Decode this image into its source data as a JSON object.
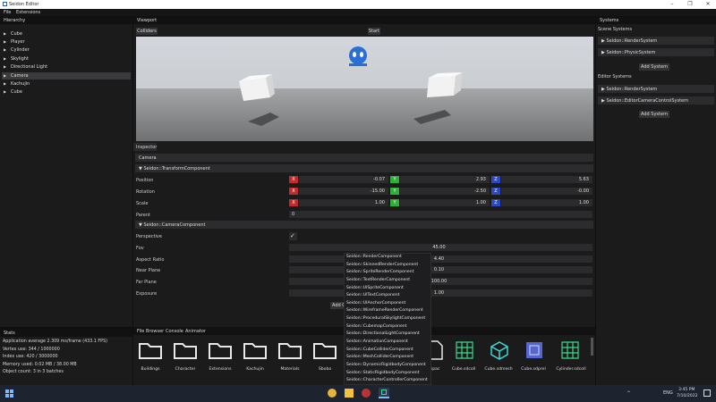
{
  "window": {
    "title": "Seidon Editor"
  },
  "menu": [
    "File",
    "Extensions"
  ],
  "hierarchy": {
    "title": "Hierarchy",
    "items": [
      "Cube",
      "Player",
      "Cylinder",
      "Skylight",
      "Directional Light",
      "Camera",
      "Kachujin",
      "Cube"
    ],
    "selected": "Camera"
  },
  "viewport": {
    "title": "Viewport",
    "colliders_label": "Colliders",
    "start_label": "Start"
  },
  "inspector": {
    "tab": "Inspector",
    "entity_name": "Camera",
    "transform": {
      "header": "Seidon::TransformComponent",
      "position": {
        "label": "Position",
        "x": "-0.07",
        "y": "2.93",
        "z": "5.63"
      },
      "rotation": {
        "label": "Rotation",
        "x": "-15.00",
        "y": "-2.50",
        "z": "-0.00"
      },
      "scale": {
        "label": "Scale",
        "x": "1.00",
        "y": "1.00",
        "z": "1.00"
      },
      "parent": {
        "label": "Parent",
        "value": "0"
      },
      "axis_labels": [
        "X",
        "Y",
        "Z"
      ]
    },
    "camera": {
      "header": "Seidon::CameraComponent",
      "perspective": "Perspective",
      "fov": {
        "label": "Fov",
        "value": "45.00"
      },
      "aspect": {
        "label": "Aspect Ratio",
        "value": "4.40"
      },
      "near": {
        "label": "Near Plane",
        "value": "0.10"
      },
      "far": {
        "label": "Far Plane",
        "value": "100.00"
      },
      "exposure": {
        "label": "Exposure",
        "value": "1.00"
      }
    },
    "add_component_label": "Add C"
  },
  "component_dropdown": [
    "Seidon::RenderComponent",
    "Seidon::SkinnedRenderComponent",
    "Seidon::SpriteRenderComponent",
    "Seidon::TextRenderComponent",
    "Seidon::UISpriteComponent",
    "Seidon::UITextComponent",
    "Seidon::UIAnchorComponent",
    "Seidon::WireframeRenderComponent",
    "Seidon::ProceduralSkylightComponent",
    "Seidon::CubemapComponent",
    "Seidon::DirectionalLightComponent",
    "Seidon::AnimationComponent",
    "Seidon::CubeColliderComponent",
    "Seidon::MeshColliderComponent",
    "Seidon::DynamicRigidbodyComponent",
    "Seidon::StaticRigidbodyComponent",
    "Seidon::CharacterControllerComponent"
  ],
  "systems": {
    "title": "Systems",
    "scene_label": "Scene Systems",
    "scene": [
      "Seidon::RenderSystem",
      "Seidon::PhysicSystem"
    ],
    "editor_label": "Editor Systems",
    "editor": [
      "Seidon::RenderSystem",
      "Seidon::EditorCameraControlSystem"
    ],
    "add_label": "Add System"
  },
  "stats": {
    "title": "Stats",
    "lines": [
      "Application average 2.309 ms/frame (433.1 FPS)",
      "Vertex use: 344 / 1000000",
      "Index use: 420 / 3000000",
      "Memory used: 0.02 MB / 38.00 MB",
      "Object count: 3 in 3 batches"
    ]
  },
  "file_browser": {
    "tabs": [
      "File Browser",
      "Console",
      "Animator"
    ],
    "items": [
      "Buildings",
      "Character",
      "Extensions",
      "Kachujin",
      "Materials",
      "Sbobo",
      "...spac",
      "Cube.sdcoll",
      "Cube.sdmesh",
      "Cube.sdprel",
      "Cylinder.sdcoll"
    ]
  },
  "taskbar": {
    "time": "3:45 PM",
    "date": "7/10/2022",
    "lang": "ENG"
  },
  "colors": {
    "accent_x": "#c22b2b",
    "accent_y": "#2fae3a",
    "accent_z": "#2b49c2",
    "sky": "#d9dde4",
    "ground": "#8a8c8e"
  }
}
